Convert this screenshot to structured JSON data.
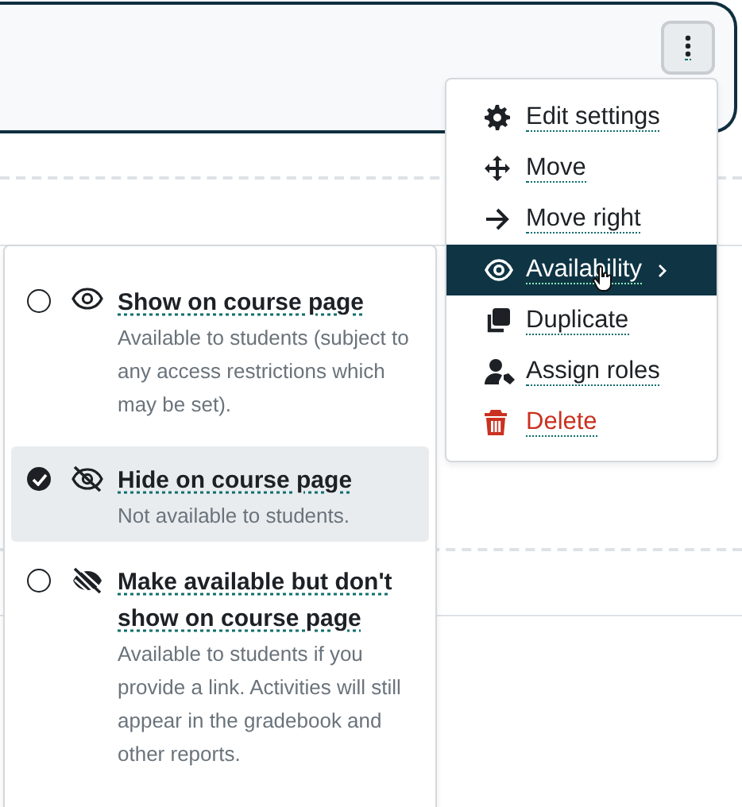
{
  "action_menu": {
    "items": [
      {
        "label": "Edit settings",
        "kind": "normal",
        "selected": false,
        "submenu": false
      },
      {
        "label": "Move",
        "kind": "normal",
        "selected": false,
        "submenu": false
      },
      {
        "label": "Move right",
        "kind": "normal",
        "selected": false,
        "submenu": false
      },
      {
        "label": "Availability",
        "kind": "normal",
        "selected": true,
        "submenu": true
      },
      {
        "label": "Duplicate",
        "kind": "normal",
        "selected": false,
        "submenu": false
      },
      {
        "label": "Assign roles",
        "kind": "normal",
        "selected": false,
        "submenu": false
      },
      {
        "label": "Delete",
        "kind": "danger",
        "selected": false,
        "submenu": false
      }
    ]
  },
  "availability_menu": {
    "options": [
      {
        "title": "Show on course page",
        "description": "Available to students (subject to any access restrictions which may be set).",
        "selected": false
      },
      {
        "title": "Hide on course page",
        "description": "Not available to students.",
        "selected": true
      },
      {
        "title": "Make available but don't show on course page",
        "description": "Available to students if you provide a link. Activities will still appear in the gradebook and other reports.",
        "selected": false
      }
    ]
  }
}
